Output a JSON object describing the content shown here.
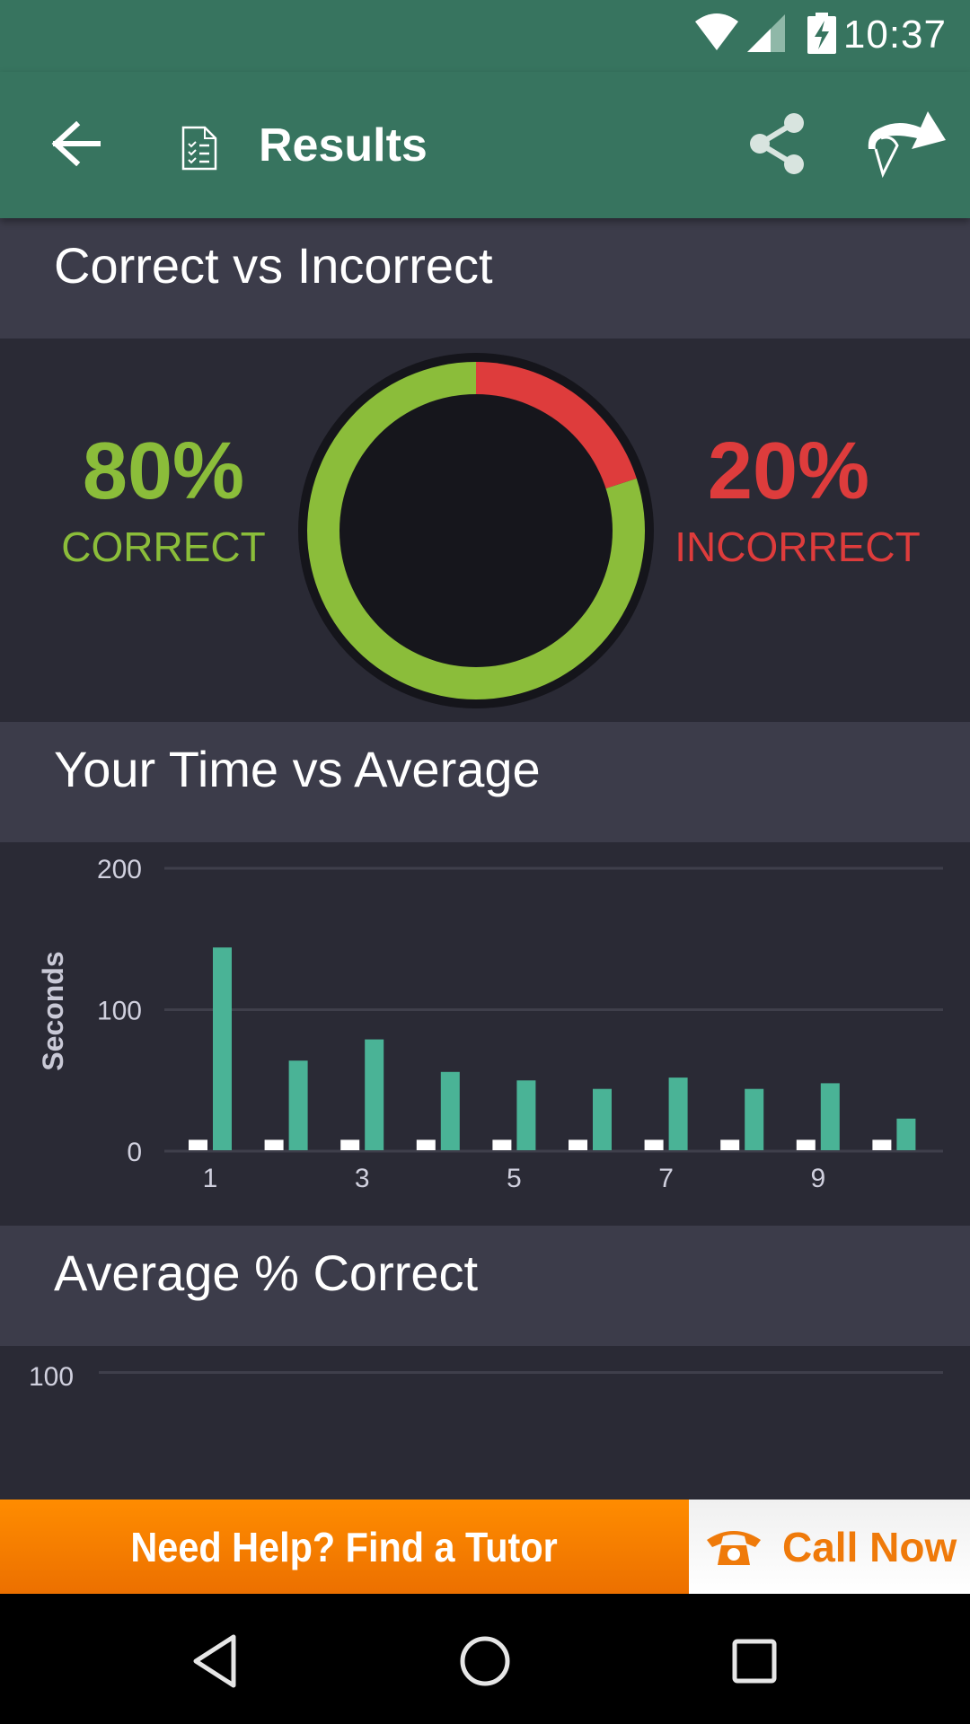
{
  "status_bar": {
    "time": "10:37",
    "icons": [
      "wifi-icon",
      "cellular-signal-icon",
      "battery-charging-icon"
    ]
  },
  "app_bar": {
    "title": "Results",
    "back_icon": "arrow-left-icon",
    "title_icon": "checklist-document-icon",
    "actions": [
      "share-icon",
      "forward-arrow-icon"
    ],
    "color": "#37745f"
  },
  "sections": {
    "correct_vs_incorrect": {
      "title": "Correct vs Incorrect",
      "correct_pct": "80%",
      "correct_label": "CORRECT",
      "incorrect_pct": "20%",
      "incorrect_label": "INCORRECT",
      "correct_color": "#8bbd3a",
      "incorrect_color": "#de3c3c"
    },
    "time_vs_average": {
      "title": "Your Time vs Average"
    },
    "average_correct": {
      "title": "Average % Correct"
    }
  },
  "chart_data": [
    {
      "type": "pie",
      "title": "Correct vs Incorrect",
      "style": "donut",
      "categories": [
        "Incorrect",
        "Correct"
      ],
      "values": [
        20,
        80
      ],
      "colors": [
        "#de3c3c",
        "#8bbd3a"
      ]
    },
    {
      "type": "bar",
      "title": "Your Time vs Average",
      "xlabel": "",
      "ylabel": "Seconds",
      "categories": [
        "1",
        "2",
        "3",
        "4",
        "5",
        "6",
        "7",
        "8",
        "9",
        "10"
      ],
      "x_tick_labels": [
        "1",
        "3",
        "5",
        "7",
        "9"
      ],
      "y_ticks": [
        "0",
        "100",
        "200"
      ],
      "ylim": [
        0,
        200
      ],
      "grid": true,
      "series": [
        {
          "name": "Your Time",
          "color": "#ffffff",
          "values": [
            8,
            8,
            8,
            8,
            8,
            8,
            8,
            8,
            8,
            8
          ]
        },
        {
          "name": "Average",
          "color": "#4ab396",
          "values": [
            144,
            64,
            79,
            56,
            50,
            44,
            52,
            44,
            48,
            23
          ]
        }
      ]
    },
    {
      "type": "line",
      "title": "Average % Correct",
      "y_ticks": [
        "100"
      ],
      "grid": true,
      "series": []
    }
  ],
  "banner": {
    "left_text": "Need Help? Find a Tutor",
    "right_text": "Call Now",
    "right_icon": "telephone-icon"
  },
  "nav_bar": {
    "buttons": [
      "back-triangle-icon",
      "home-circle-icon",
      "recents-square-icon"
    ]
  }
}
